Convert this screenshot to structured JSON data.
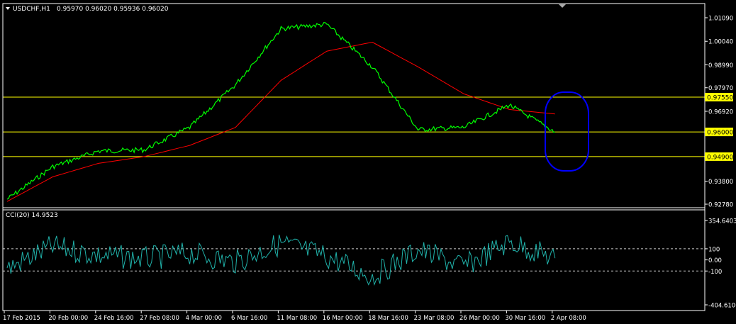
{
  "colors": {
    "background": "#000000",
    "axes": "#ffffff",
    "price": "#00ff00",
    "moving_average": "#ff0000",
    "support_resistance": "#ffff00",
    "cci": "#20b2aa",
    "ellipse": "#0000ff",
    "level_label_bg": "#ffff00"
  },
  "icons": {
    "symbol_dropdown": "triangle-down-icon",
    "scroll_marker": "triangle-down-icon"
  },
  "chart_data": [
    {
      "type": "line",
      "title": "USDCHF,H1",
      "ohlc": "0.95970 0.96020 0.95936 0.96020",
      "ylim": [
        0.9278,
        1.0109
      ],
      "y_ticks": [
        "1.01090",
        "1.00040",
        "0.98990",
        "0.97970",
        "0.96920",
        "0.95950",
        "0.93800",
        "0.92780"
      ],
      "x_ticks": [
        "17 Feb 2015",
        "20 Feb 00:00",
        "24 Feb 16:00",
        "27 Feb 08:00",
        "4 Mar 00:00",
        "6 Mar 16:00",
        "11 Mar 08:00",
        "16 Mar 00:00",
        "18 Mar 16:00",
        "23 Mar 08:00",
        "26 Mar 00:00",
        "30 Mar 16:00",
        "2 Apr 08:00"
      ],
      "horizontal_levels": [
        {
          "value": 0.9755,
          "label": "0.97550"
        },
        {
          "value": 0.96,
          "label": "0.96000"
        },
        {
          "value": 0.949,
          "label": "0.94900"
        }
      ],
      "series": [
        {
          "role": "price",
          "x": [
            "17 Feb 2015",
            "20 Feb 00:00",
            "24 Feb 16:00",
            "27 Feb 08:00",
            "4 Mar 00:00",
            "6 Mar 16:00",
            "11 Mar 08:00",
            "16 Mar 00:00",
            "18 Mar 16:00",
            "23 Mar 08:00",
            "26 Mar 00:00",
            "30 Mar 16:00",
            "2 Apr 08:00"
          ],
          "y": [
            0.93,
            0.9445,
            0.9515,
            0.952,
            0.962,
            0.981,
            1.006,
            1.008,
            0.989,
            0.961,
            0.962,
            0.972,
            0.96
          ]
        },
        {
          "role": "moving_average",
          "x": [
            "17 Feb 2015",
            "20 Feb 00:00",
            "24 Feb 16:00",
            "27 Feb 08:00",
            "4 Mar 00:00",
            "6 Mar 16:00",
            "11 Mar 08:00",
            "16 Mar 00:00",
            "18 Mar 16:00",
            "23 Mar 08:00",
            "26 Mar 00:00",
            "30 Mar 16:00",
            "2 Apr 08:00"
          ],
          "y": [
            0.929,
            0.94,
            0.946,
            0.949,
            0.954,
            0.962,
            0.983,
            0.996,
            1.0,
            0.989,
            0.977,
            0.97,
            0.968
          ]
        }
      ]
    },
    {
      "type": "line",
      "title": "CCI(20) 14.9523",
      "ylim": [
        -404.6106,
        354.6403
      ],
      "y_ticks": [
        "354.6403",
        "100",
        "0.00",
        "-100",
        "-404.6106"
      ],
      "dashed_levels": [
        100,
        -100
      ],
      "series": [
        {
          "role": "cci",
          "x": [
            "17 Feb 2015",
            "20 Feb 00:00",
            "24 Feb 16:00",
            "27 Feb 08:00",
            "4 Mar 00:00",
            "6 Mar 16:00",
            "11 Mar 08:00",
            "16 Mar 00:00",
            "18 Mar 16:00",
            "23 Mar 08:00",
            "26 Mar 00:00",
            "30 Mar 16:00",
            "2 Apr 08:00"
          ],
          "y": [
            -80,
            120,
            40,
            10,
            60,
            -20,
            150,
            30,
            -150,
            90,
            -60,
            160,
            15
          ]
        }
      ]
    }
  ]
}
